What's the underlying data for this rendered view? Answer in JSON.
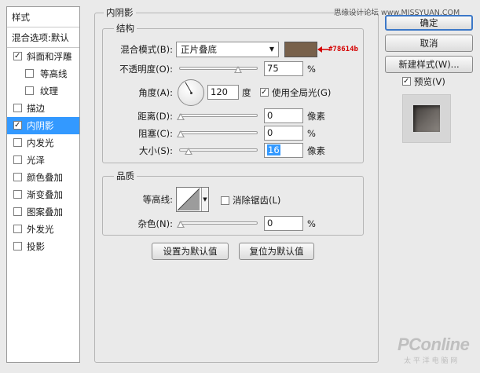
{
  "watermark_top": "思缘设计论坛 www.MISSYUAN.COM",
  "styles_panel": {
    "header": "样式",
    "blend_options": "混合选项:默认",
    "items": [
      {
        "label": "斜面和浮雕",
        "checked": true
      },
      {
        "label": "等高线",
        "checked": false
      },
      {
        "label": "纹理",
        "checked": false
      },
      {
        "label": "描边",
        "checked": false
      },
      {
        "label": "内阴影",
        "checked": true
      },
      {
        "label": "内发光",
        "checked": false
      },
      {
        "label": "光泽",
        "checked": false
      },
      {
        "label": "颜色叠加",
        "checked": false
      },
      {
        "label": "渐变叠加",
        "checked": false
      },
      {
        "label": "图案叠加",
        "checked": false
      },
      {
        "label": "外发光",
        "checked": false
      },
      {
        "label": "投影",
        "checked": false
      }
    ]
  },
  "inner_shadow": {
    "title": "内阴影",
    "structure": {
      "title": "结构",
      "blend_mode_label": "混合模式(B):",
      "blend_mode_value": "正片叠底",
      "color_hex": "#78614b",
      "color_annotation": "#78614b",
      "opacity_label": "不透明度(O):",
      "opacity_value": "75",
      "opacity_unit": "%",
      "angle_label": "角度(A):",
      "angle_value": "120",
      "angle_unit": "度",
      "global_light_label": "使用全局光(G)",
      "global_light_checked": true,
      "distance_label": "距离(D):",
      "distance_value": "0",
      "distance_unit": "像素",
      "choke_label": "阻塞(C):",
      "choke_value": "0",
      "choke_unit": "%",
      "size_label": "大小(S):",
      "size_value": "16",
      "size_unit": "像素"
    },
    "quality": {
      "title": "品质",
      "contour_label": "等高线:",
      "anti_alias_label": "消除锯齿(L)",
      "anti_alias_checked": false,
      "noise_label": "杂色(N):",
      "noise_value": "0",
      "noise_unit": "%"
    },
    "set_default_button": "设置为默认值",
    "reset_default_button": "复位为默认值"
  },
  "right_panel": {
    "ok_button": "确定",
    "cancel_button": "取消",
    "new_style_button": "新建样式(W)...",
    "preview_label": "预览(V)",
    "preview_checked": true
  },
  "watermark_bottom": {
    "brand": "PConline",
    "tagline": "太 平 洋 电 脑 网"
  }
}
